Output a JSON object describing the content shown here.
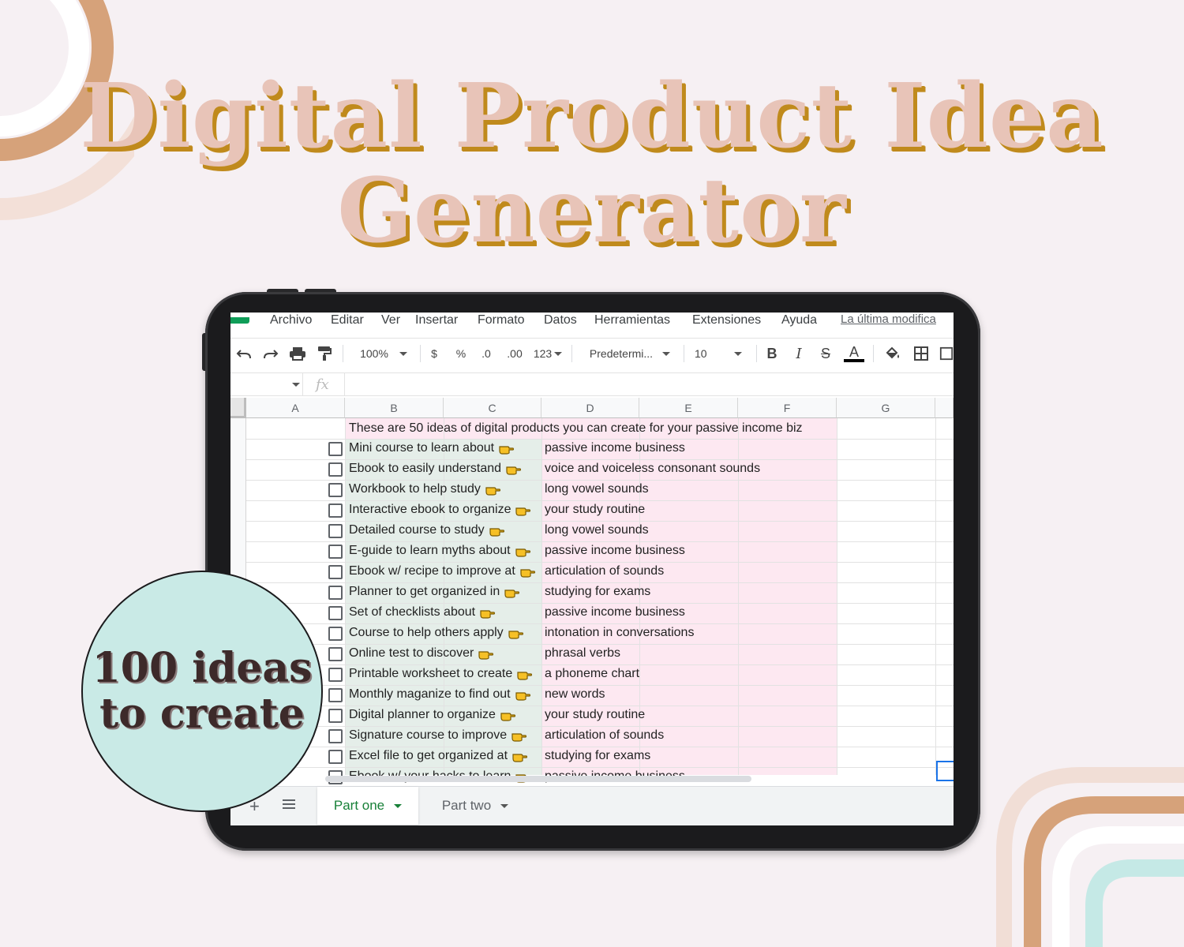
{
  "title": {
    "line1": "Digital Product Idea",
    "line2": "Generator"
  },
  "badge": {
    "line1": "100 ideas",
    "line2": "to create"
  },
  "colors": {
    "background": "#f6f0f3",
    "title_fill": "#e8c4b8",
    "title_shadow": "#c08a1c",
    "badge": "#c9eae6",
    "pink_cells": "#fde8f1",
    "green_cells": "#e5eee9",
    "active_tab": "#188038"
  },
  "menu": [
    "Archivo",
    "Editar",
    "Ver",
    "Insertar",
    "Formato",
    "Datos",
    "Herramientas",
    "Extensiones",
    "Ayuda"
  ],
  "last_edit": "La última modifica",
  "toolbar": {
    "zoom": "100%",
    "currency": "$",
    "percent": "%",
    "dec_less": ".0",
    "dec_more": ".00",
    "format": "123",
    "font": "Predetermi...",
    "font_size": "10",
    "bold": "B",
    "italic": "I",
    "strike": "S",
    "text_color": "A"
  },
  "formula_bar": {
    "fx": "fx"
  },
  "columns": [
    "A",
    "B",
    "C",
    "D",
    "E",
    "F",
    "G"
  ],
  "intro": "These are 50 ideas of digital products you can create for your passive income biz",
  "rows": [
    {
      "idea": "Mini course to learn about",
      "topic": "passive income business"
    },
    {
      "idea": "Ebook to easily understand",
      "topic": "voice and voiceless consonant sounds"
    },
    {
      "idea": "Workbook to help study",
      "topic": "long vowel sounds"
    },
    {
      "idea": "Interactive ebook to organize",
      "topic": "your study routine"
    },
    {
      "idea": "Detailed course to study",
      "topic": "long vowel sounds"
    },
    {
      "idea": "E-guide to learn myths about",
      "topic": "passive income business"
    },
    {
      "idea": "Ebook w/ recipe to improve at",
      "topic": "articulation of sounds"
    },
    {
      "idea": "Planner to get organized in",
      "topic": "studying for exams"
    },
    {
      "idea": "Set of checklists about",
      "topic": "passive income business"
    },
    {
      "idea": "Course to help others apply",
      "topic": "intonation in conversations"
    },
    {
      "idea": "Online test to discover",
      "topic": "phrasal verbs"
    },
    {
      "idea": "Printable worksheet to create",
      "topic": "a phoneme chart"
    },
    {
      "idea": "Monthly maganize to find out",
      "topic": "new words"
    },
    {
      "idea": "Digital planner to organize",
      "topic": "your study routine"
    },
    {
      "idea": "Signature course to improve",
      "topic": "articulation of sounds"
    },
    {
      "idea": "Excel file to get organized at",
      "topic": "studying for exams"
    },
    {
      "idea": "Ebook w/ your hacks to learn",
      "topic": "passive income business"
    }
  ],
  "tabs": [
    {
      "label": "Part one",
      "active": true
    },
    {
      "label": "Part two",
      "active": false
    }
  ]
}
